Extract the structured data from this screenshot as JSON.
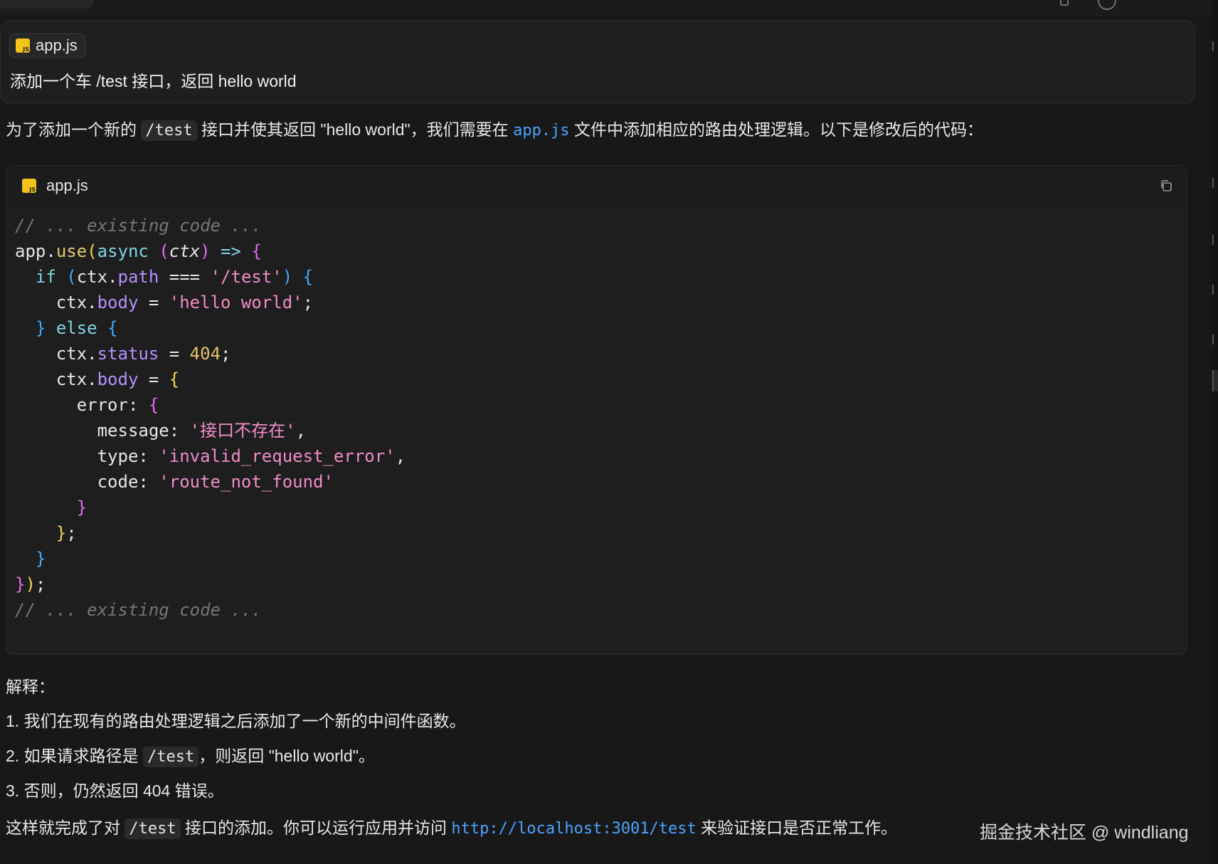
{
  "user_message": {
    "file_chip": {
      "icon": "js-file-icon",
      "label": "app.js"
    },
    "text": "添加一个车 /test 接口，返回 hello world"
  },
  "response": {
    "intro": {
      "part1": "为了添加一个新的 ",
      "code1": "/test",
      "part2": " 接口并使其返回 \"hello world\"，我们需要在 ",
      "code2": "app.js",
      "part3": " 文件中添加相应的路由处理逻辑。以下是修改后的代码："
    },
    "code_block": {
      "filename": "app.js",
      "copy_icon": "copy-icon",
      "t": {
        "existing": "// ... existing code ...",
        "app": "app",
        "dot": ".",
        "use": "use",
        "lparen": "(",
        "rparen": ")",
        "async": "async",
        "ctx": "ctx",
        "arrow": "=>",
        "lbrace": "{",
        "rbrace": "}",
        "if": "if",
        "path": "path",
        "eqeq": "===",
        "test_str": "'/test'",
        "body": "body",
        "eq": "=",
        "hello_str": "'hello world'",
        "semi": ";",
        "else": "else",
        "status": "status",
        "n404": "404",
        "error": "error",
        "colon": ":",
        "message": "message",
        "msg_str": "'接口不存在'",
        "comma": ",",
        "type": "type",
        "type_str": "'invalid_request_error'",
        "code": "code",
        "code_str": "'route_not_found'"
      }
    },
    "explain_title": "解释：",
    "explain_items": [
      {
        "text": "1. 我们在现有的路由处理逻辑之后添加了一个新的中间件函数。"
      },
      {
        "text_a": "2. 如果请求路径是 ",
        "code": "/test",
        "text_b": "，则返回 \"hello world\"。"
      },
      {
        "text": "3. 否则，仍然返回 404 错误。"
      }
    ],
    "closing": {
      "part1": "这样就完成了对 ",
      "code": "/test",
      "part2": " 接口的添加。你可以运行应用并访问 ",
      "url": "http://localhost:3001/test",
      "part3": " 来验证接口是否正常工作。"
    }
  },
  "watermark": "掘金技术社区 @ windliang"
}
